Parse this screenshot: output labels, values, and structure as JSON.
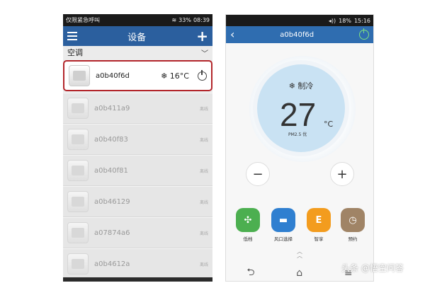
{
  "left": {
    "status_left": "仅限紧急呼叫",
    "status_battery": "33%",
    "status_time": "08:39",
    "header_title": "设备",
    "add_icon": "+",
    "category_label": "空调",
    "devices": [
      {
        "name": "a0b40f6d",
        "temp": "❄ 16°C",
        "active": true
      },
      {
        "name": "a0b411a9",
        "status": "离线"
      },
      {
        "name": "a0b40f83",
        "status": "离线"
      },
      {
        "name": "a0b40f81",
        "status": "离线"
      },
      {
        "name": "a0b46129",
        "status": "离线"
      },
      {
        "name": "a07874a6",
        "status": "离线"
      },
      {
        "name": "a0b4612a",
        "status": "离线"
      }
    ]
  },
  "right": {
    "status_battery": "18%",
    "status_time": "15:16",
    "header_title": "a0b40f6d",
    "mode": "❄ 制冷",
    "temperature": "27",
    "unit": "°C",
    "pm": "PM2.5  优",
    "minus": "−",
    "plus": "+",
    "functions": [
      {
        "label": "低档",
        "symbol": "✣",
        "color": "#4caf50"
      },
      {
        "label": "风口选择",
        "symbol": "▬",
        "color": "#2f7fd0"
      },
      {
        "label": "智享",
        "symbol": "E",
        "color": "#f39c1e"
      },
      {
        "label": "预约",
        "symbol": "◷",
        "color": "#a08466"
      }
    ],
    "nav": [
      "⮌",
      "⌂",
      "≡"
    ]
  },
  "watermark": "头条 @悟空问答"
}
